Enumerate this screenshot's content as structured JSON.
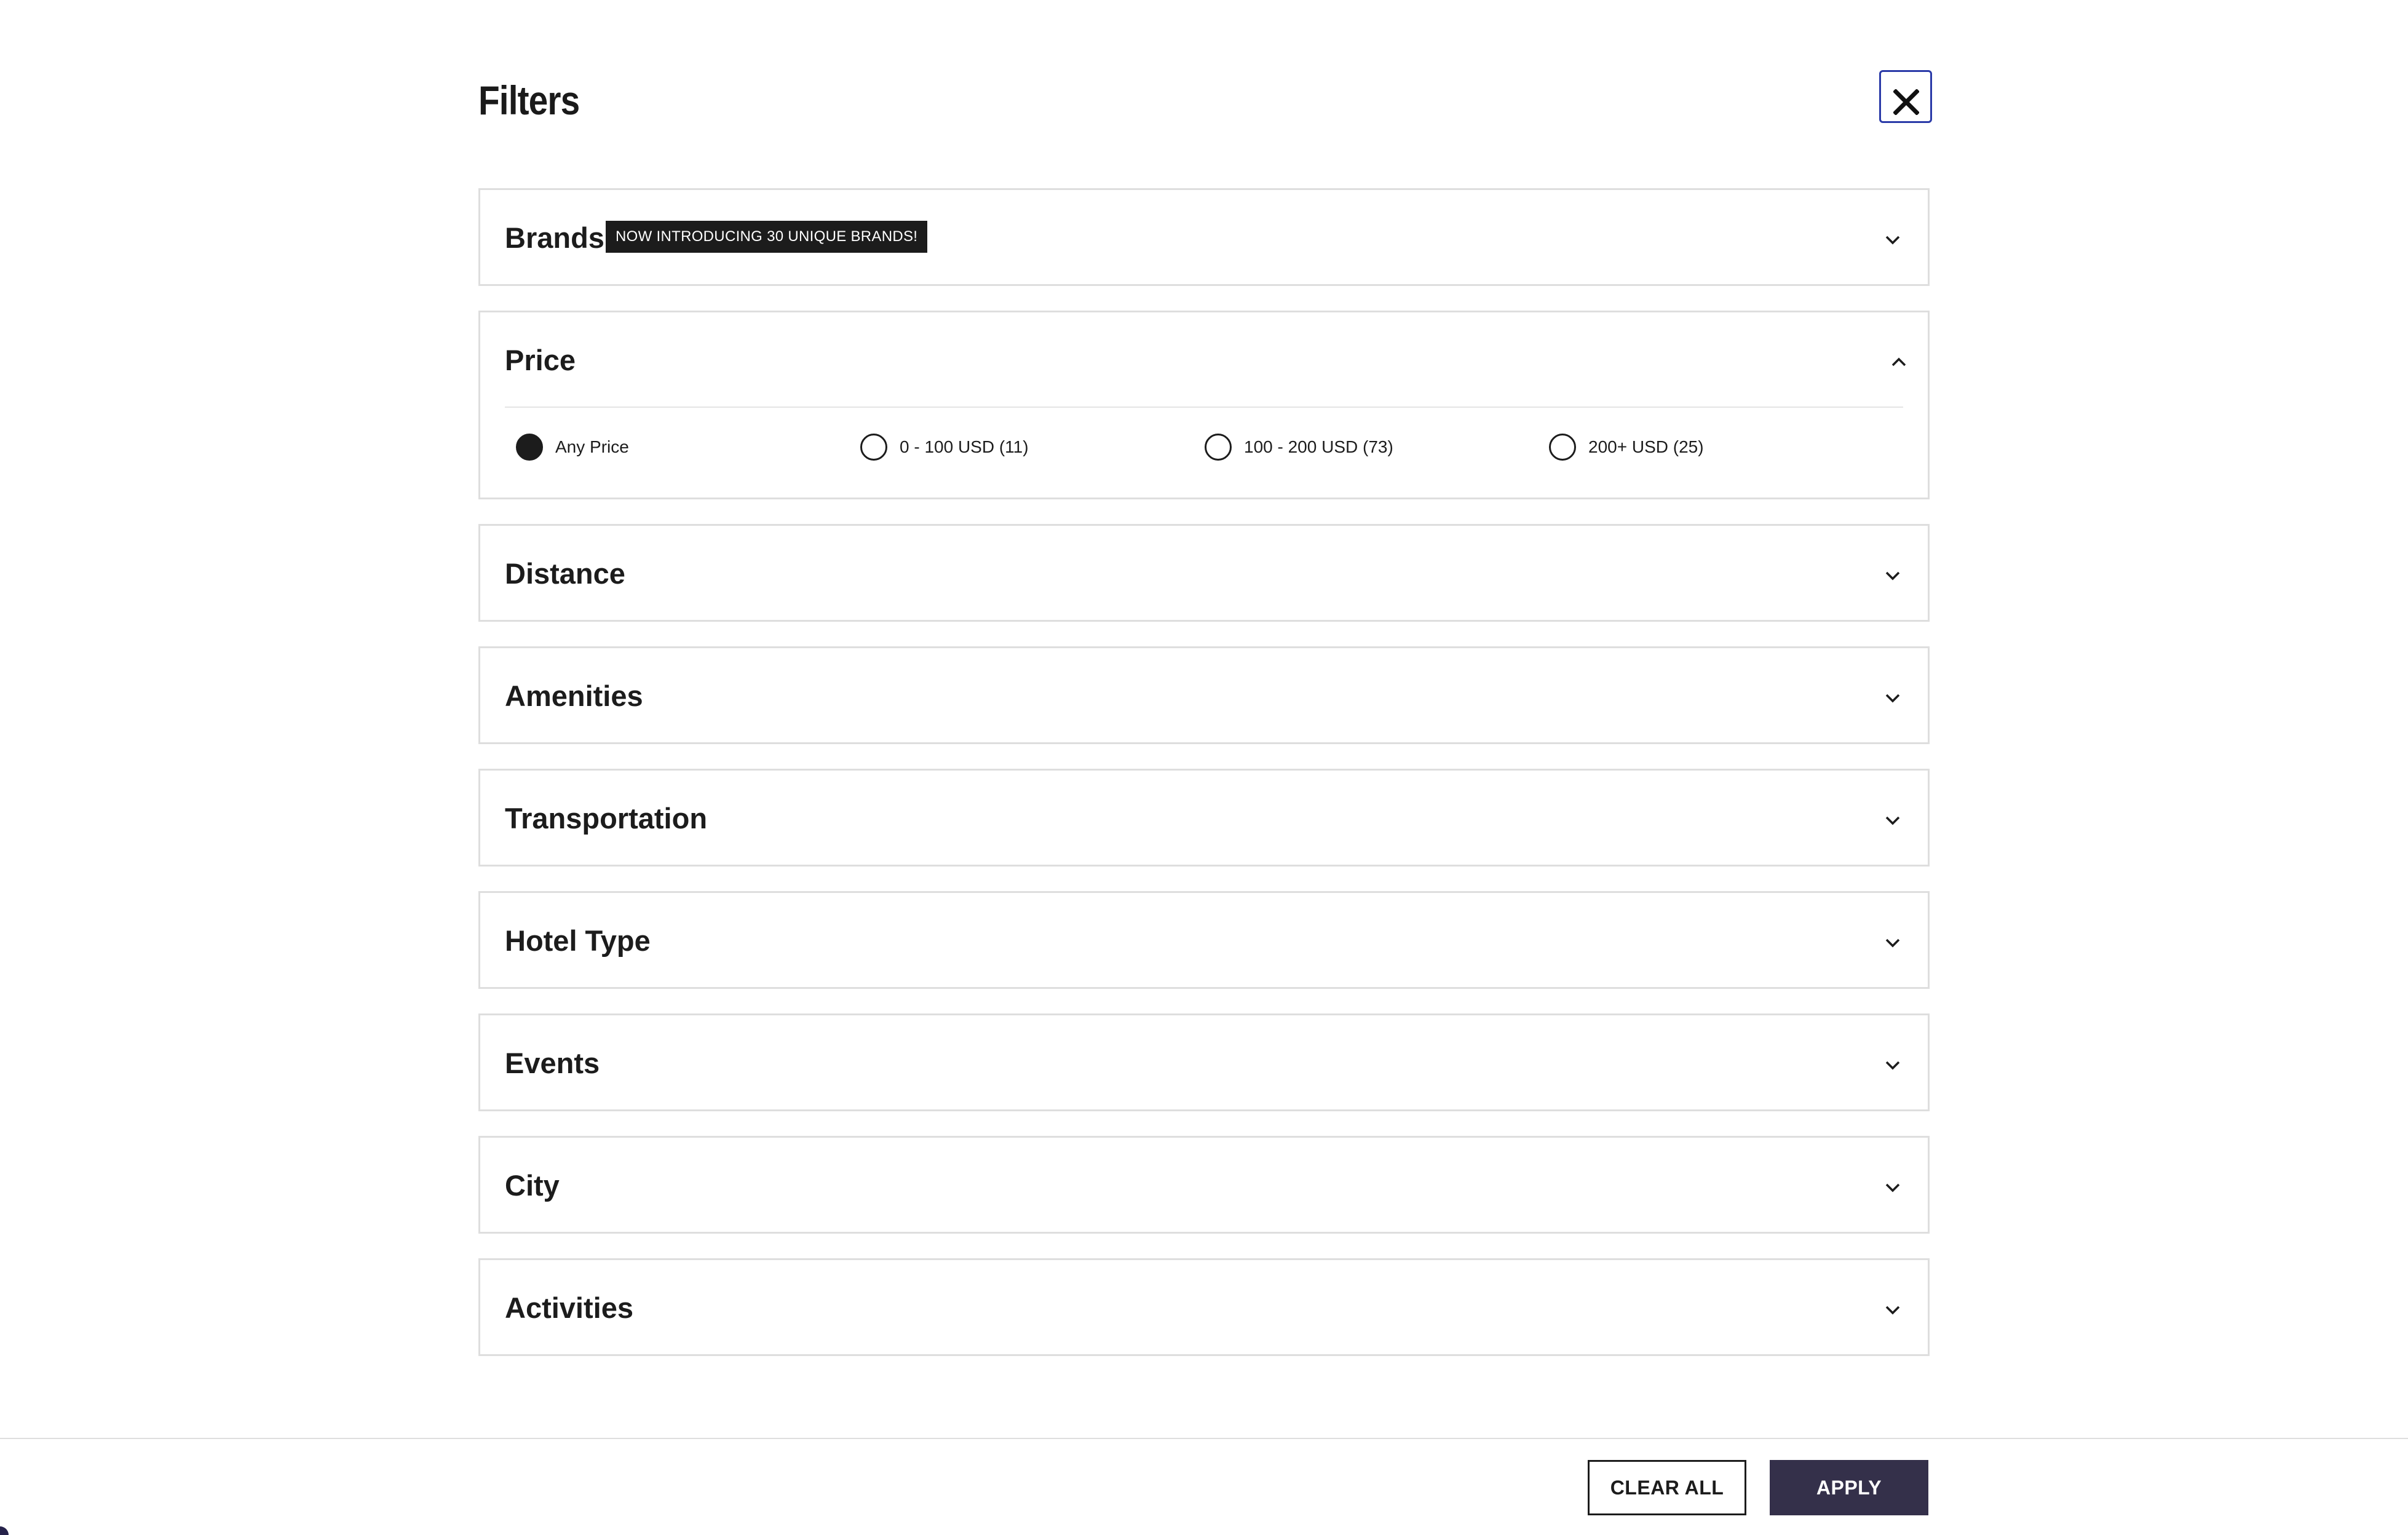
{
  "modal": {
    "title": "Filters",
    "close_icon": "close-icon"
  },
  "sections": {
    "brands": {
      "title": "Brands",
      "badge": "NOW INTRODUCING 30 UNIQUE BRANDS!",
      "expanded": false
    },
    "price": {
      "title": "Price",
      "expanded": true,
      "options": [
        {
          "label": "Any Price",
          "checked": true
        },
        {
          "label": "0 - 100 USD (11)",
          "checked": false
        },
        {
          "label": "100 - 200 USD (73)",
          "checked": false
        },
        {
          "label": "200+ USD (25)",
          "checked": false
        }
      ]
    },
    "distance": {
      "title": "Distance",
      "expanded": false
    },
    "amenities": {
      "title": "Amenities",
      "expanded": false
    },
    "transportation": {
      "title": "Transportation",
      "expanded": false
    },
    "hotel_type": {
      "title": "Hotel Type",
      "expanded": false
    },
    "events": {
      "title": "Events",
      "expanded": false
    },
    "city": {
      "title": "City",
      "expanded": false
    },
    "activities": {
      "title": "Activities",
      "expanded": false
    }
  },
  "footer": {
    "clear_label": "CLEAR ALL",
    "apply_label": "APPLY"
  },
  "colors": {
    "text": "#1c1c1c",
    "border": "#dedede",
    "close_border": "#2a3aa8",
    "apply_bg": "#34304a",
    "badge_bg": "#1c1c1c"
  }
}
